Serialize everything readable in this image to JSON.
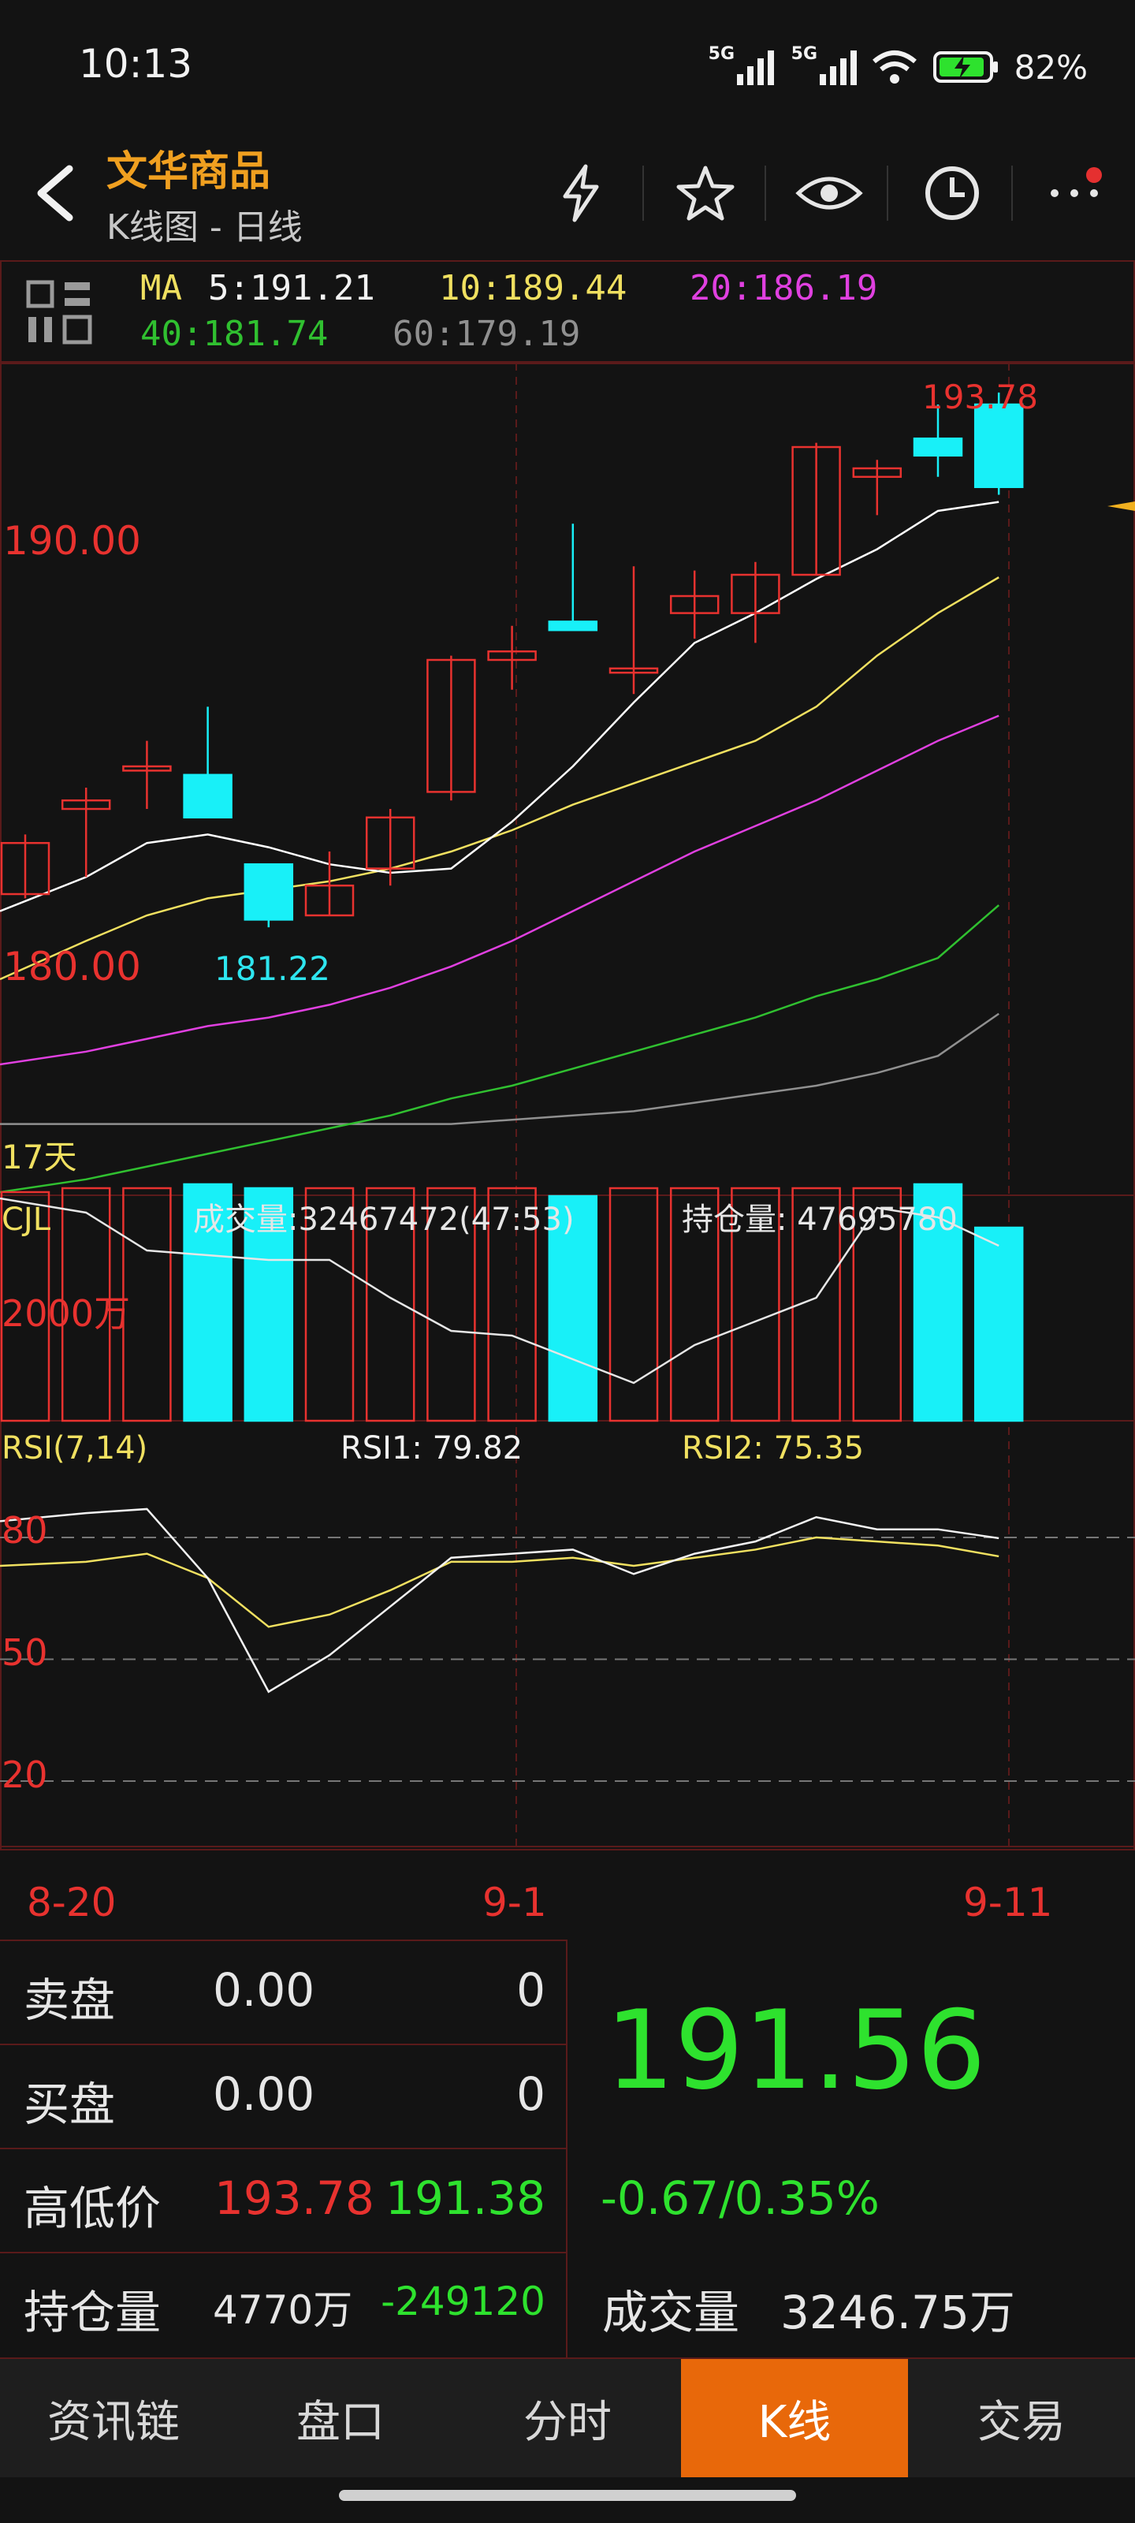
{
  "status": {
    "time": "10:13",
    "net1": "5G",
    "net2": "5G",
    "battery": "82%"
  },
  "header": {
    "title": "文华商品",
    "subtitle": "K线图 - 日线",
    "icons": [
      "back-icon",
      "flash-icon",
      "star-icon",
      "eye-icon",
      "clock-icon",
      "more-icon"
    ]
  },
  "ma": {
    "label": "MA",
    "ma5": "5:191.21",
    "ma10": "10:189.44",
    "ma20": "20:186.19",
    "ma40": "40:181.74",
    "ma60": "60:179.19",
    "colors": {
      "ma5": "#ffffff",
      "ma10": "#f0e060",
      "ma20": "#e040e0",
      "ma40": "#30c030",
      "ma60": "#909090"
    }
  },
  "chart": {
    "price_labels": {
      "p190": "190.00",
      "p180": "180.00",
      "high": "193.78",
      "low": "181.22",
      "days": "17天"
    },
    "volume": {
      "label": "CJL",
      "vol_text": "成交量:32467472(47:53)",
      "oi_text": "持仓量: 47695780",
      "scale": "2000万"
    },
    "rsi": {
      "label": "RSI(7,14)",
      "rsi1": "RSI1: 79.82",
      "rsi2": "RSI2: 75.35",
      "l80": "80",
      "l50": "50",
      "l20": "20"
    },
    "dates": [
      "8-20",
      "9-1",
      "9-11"
    ]
  },
  "chart_data": {
    "type": "candlestick",
    "candles": [
      {
        "o": 182.0,
        "c": 183.2,
        "h": 183.4,
        "l": 181.9,
        "up": true
      },
      {
        "o": 184.0,
        "c": 184.2,
        "h": 184.5,
        "l": 182.4,
        "up": true
      },
      {
        "o": 184.9,
        "c": 185.0,
        "h": 185.6,
        "l": 184.0,
        "up": true
      },
      {
        "o": 184.8,
        "c": 183.8,
        "h": 186.4,
        "l": 183.8,
        "up": false
      },
      {
        "o": 182.7,
        "c": 181.4,
        "h": 182.7,
        "l": 181.22,
        "up": false
      },
      {
        "o": 181.5,
        "c": 182.2,
        "h": 183.0,
        "l": 181.5,
        "up": true
      },
      {
        "o": 182.6,
        "c": 183.8,
        "h": 184.0,
        "l": 182.2,
        "up": true
      },
      {
        "o": 184.4,
        "c": 187.5,
        "h": 187.6,
        "l": 184.2,
        "up": true
      },
      {
        "o": 187.5,
        "c": 187.7,
        "h": 188.3,
        "l": 186.8,
        "up": true
      },
      {
        "o": 188.4,
        "c": 188.2,
        "h": 190.7,
        "l": 188.2,
        "up": false
      },
      {
        "o": 187.2,
        "c": 187.3,
        "h": 189.7,
        "l": 186.7,
        "up": true
      },
      {
        "o": 188.6,
        "c": 189.0,
        "h": 189.6,
        "l": 188.0,
        "up": true
      },
      {
        "o": 188.6,
        "c": 189.5,
        "h": 189.8,
        "l": 187.9,
        "up": true
      },
      {
        "o": 189.5,
        "c": 192.5,
        "h": 192.6,
        "l": 189.5,
        "up": true
      },
      {
        "o": 191.8,
        "c": 192.0,
        "h": 192.2,
        "l": 190.9,
        "up": true
      },
      {
        "o": 192.7,
        "c": 192.3,
        "h": 193.5,
        "l": 191.8,
        "up": false
      },
      {
        "o": 193.5,
        "c": 191.56,
        "h": 193.78,
        "l": 191.38,
        "up": false
      }
    ],
    "ma5": [
      181.6,
      182.4,
      183.2,
      183.4,
      183.1,
      182.7,
      182.5,
      182.6,
      183.7,
      185.0,
      186.5,
      187.9,
      188.6,
      189.4,
      190.1,
      191.0,
      191.21
    ],
    "ma10": [
      180.0,
      180.9,
      181.5,
      181.9,
      182.1,
      182.3,
      182.6,
      183.0,
      183.5,
      184.1,
      184.6,
      185.1,
      185.6,
      186.4,
      187.6,
      188.6,
      189.44
    ],
    "ma20": [
      178.0,
      178.3,
      178.6,
      178.9,
      179.1,
      179.4,
      179.8,
      180.3,
      180.9,
      181.6,
      182.3,
      183.0,
      183.6,
      184.2,
      184.9,
      185.6,
      186.19
    ],
    "ma40": [
      175.0,
      175.3,
      175.6,
      175.9,
      176.2,
      176.5,
      176.8,
      177.2,
      177.5,
      177.9,
      178.3,
      178.7,
      179.1,
      179.6,
      180.0,
      180.5,
      181.74
    ],
    "ma60": [
      176.6,
      176.6,
      176.6,
      176.6,
      176.6,
      176.6,
      176.6,
      176.6,
      176.7,
      176.8,
      176.9,
      177.1,
      177.3,
      177.5,
      177.8,
      178.2,
      179.19
    ],
    "volume": [
      2900,
      2950,
      2950,
      3000,
      2950,
      2950,
      2950,
      2950,
      2950,
      2850,
      2950,
      2950,
      2950,
      2950,
      2950,
      3000,
      2450
    ],
    "oi": [
      2350,
      2200,
      1800,
      1750,
      1700,
      1700,
      1300,
      950,
      900,
      650,
      400,
      800,
      1050,
      1300,
      2250,
      2150,
      1850
    ],
    "rsi1": [
      84,
      86,
      87,
      70,
      42,
      51,
      63,
      75,
      76,
      77,
      71,
      76,
      79,
      85,
      82,
      82,
      79.82
    ],
    "rsi2": [
      73,
      74,
      76,
      70,
      58,
      61,
      67,
      74,
      74,
      75,
      73,
      75,
      77,
      80,
      79,
      78,
      75.35
    ]
  },
  "stats": {
    "sell_label": "卖盘",
    "sell_price": "0.00",
    "sell_qty": "0",
    "buy_label": "买盘",
    "buy_price": "0.00",
    "buy_qty": "0",
    "hl_label": "高低价",
    "high": "193.78",
    "low": "191.38",
    "oi_label": "持仓量",
    "oi": "4770万",
    "oi_change": "-249120",
    "last_price": "191.56",
    "change": "-0.67/0.35%",
    "vol_label": "成交量",
    "vol": "3246.75万"
  },
  "tabs": [
    "资讯链",
    "盘口",
    "分时",
    "K线",
    "交易"
  ],
  "active_tab": "K线"
}
